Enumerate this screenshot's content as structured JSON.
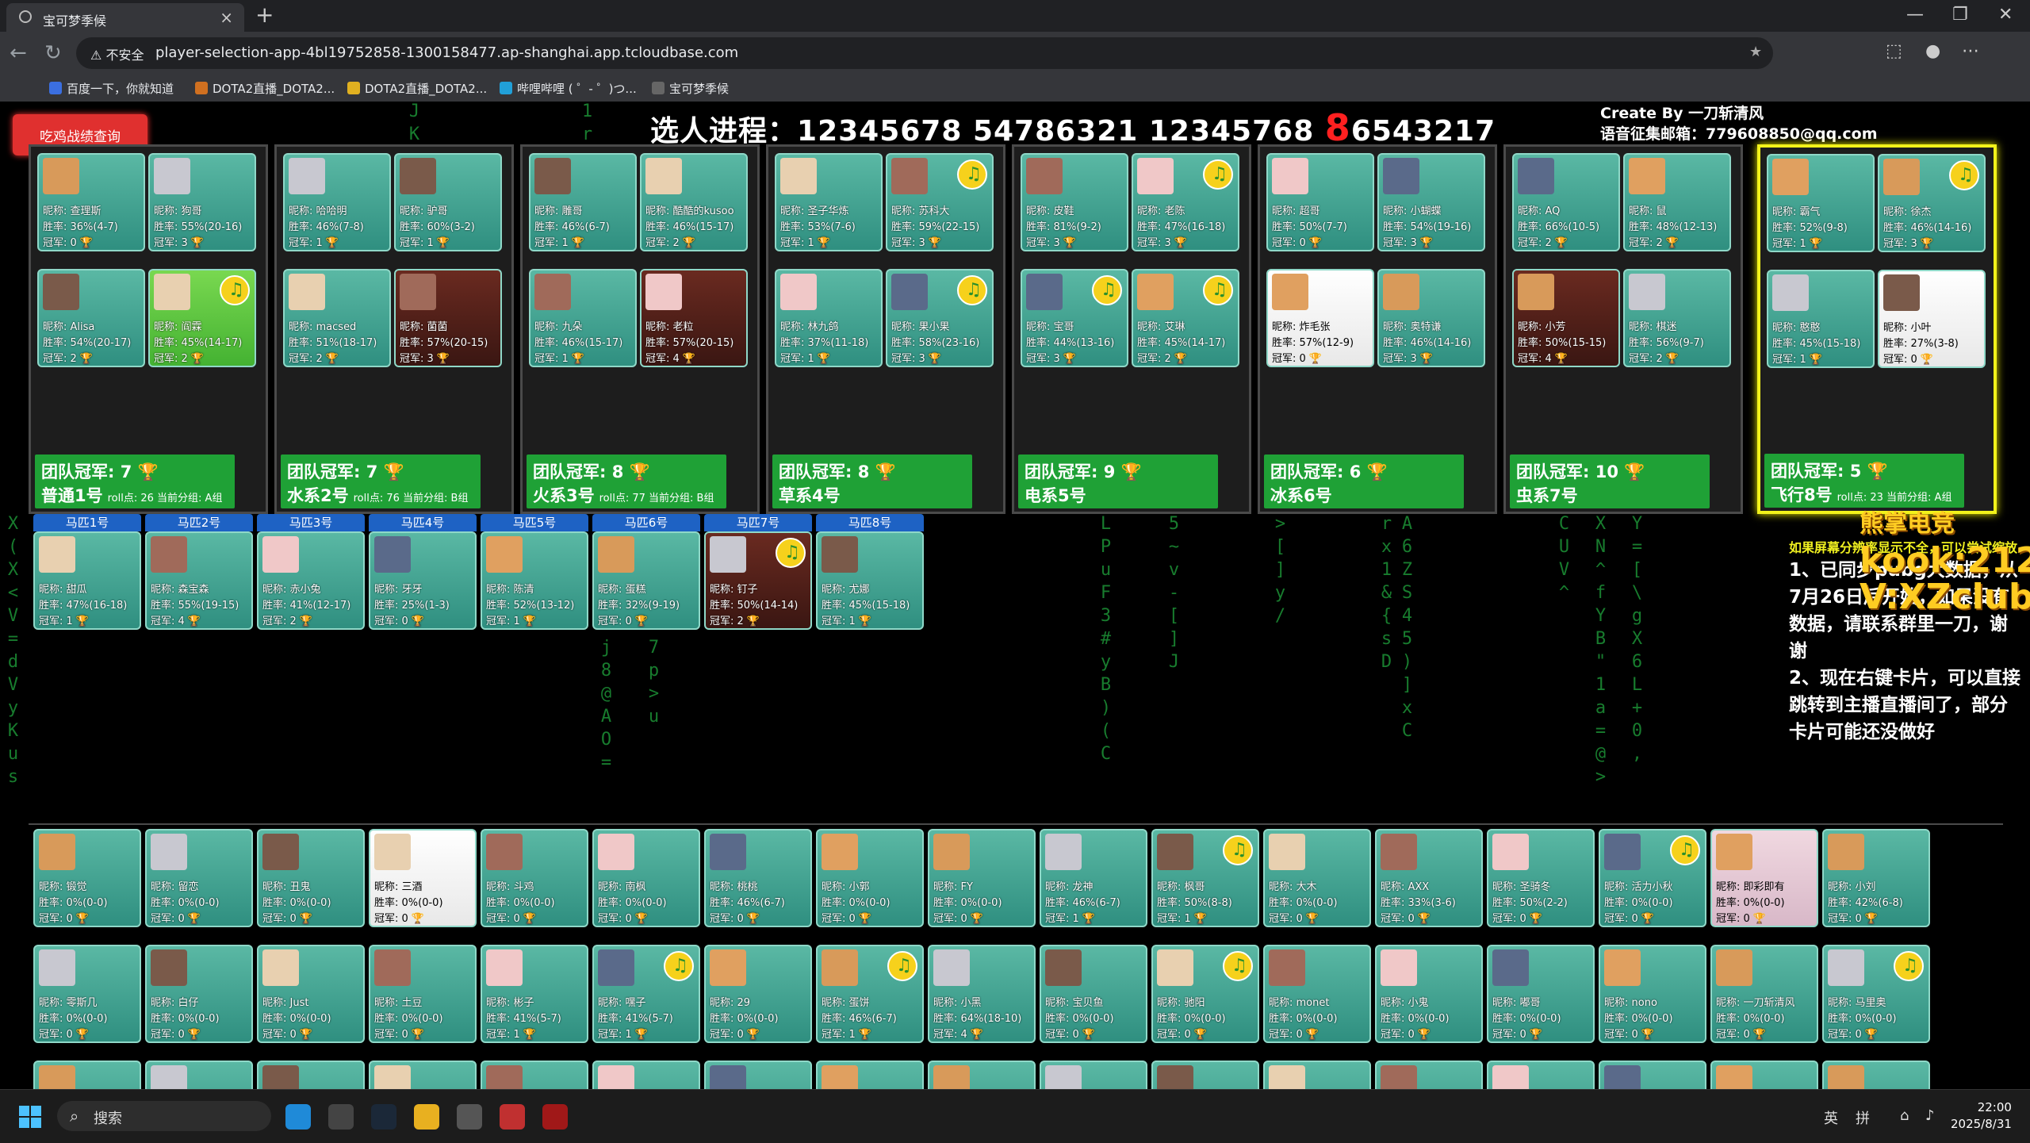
{
  "browser": {
    "tab_title": "宝可梦季候",
    "security_label": "不安全",
    "url": "player-selection-app-4bl19752858-1300158477.ap-shanghai.app.tcloudbase.com",
    "bookmarks": [
      "百度一下，你就知道",
      "DOTA2直播_DOTA2...",
      "DOTA2直播_DOTA2...",
      "哔哩哔哩 ( ゜- ゜)つ...",
      "宝可梦季候"
    ]
  },
  "page": {
    "query_button": "吃鸡战绩查询",
    "progress_label": "选人进程：",
    "progress_seq": "12345678 54786321 12345768 ",
    "progress_red": "8",
    "progress_tail": "6543217",
    "credit_line1": "Create By 一刀斩清风",
    "credit_line2": "语音征集邮箱：779608850@qq.com"
  },
  "teams": [
    {
      "crown": "团队冠军: 7 🏆",
      "name": "普通1号",
      "extra": "roll点: 26 当前分组: A组",
      "players": [
        {
          "n": "昵称: 查理斯",
          "w": "胜率: 36%(4-7)",
          "c": "冠军: 0 🏆"
        },
        {
          "n": "昵称: 狗哥",
          "w": "胜率: 55%(20-16)",
          "c": "冠军: 3 🏆"
        },
        {
          "n": "昵称: Alisa",
          "w": "胜率: 54%(20-17)",
          "c": "冠军: 2 🏆"
        },
        {
          "n": "昵称: 阎霖",
          "w": "胜率: 45%(14-17)",
          "c": "冠军: 2 🏆",
          "hl": true,
          "sp": true
        }
      ]
    },
    {
      "crown": "团队冠军: 7 🏆",
      "name": "水系2号",
      "extra": "roll点: 76 当前分组: B组",
      "players": [
        {
          "n": "昵称: 哈哈明",
          "w": "胜率: 46%(7-8)",
          "c": "冠军: 1 🏆"
        },
        {
          "n": "昵称: 驴哥",
          "w": "胜率: 60%(3-2)",
          "c": "冠军: 1 🏆"
        },
        {
          "n": "昵称: macsed",
          "w": "胜率: 51%(18-17)",
          "c": "冠军: 2 🏆"
        },
        {
          "n": "昵称: 菌菌",
          "w": "胜率: 57%(20-15)",
          "c": "冠军: 3 🏆",
          "dark": true
        }
      ]
    },
    {
      "crown": "团队冠军: 8 🏆",
      "name": "火系3号",
      "extra": "roll点: 77 当前分组: B组",
      "players": [
        {
          "n": "昵称: 雕哥",
          "w": "胜率: 46%(6-7)",
          "c": "冠军: 1 🏆"
        },
        {
          "n": "昵称: 酷酷的kusoo",
          "w": "胜率: 46%(15-17)",
          "c": "冠军: 2 🏆"
        },
        {
          "n": "昵称: 九朵",
          "w": "胜率: 46%(15-17)",
          "c": "冠军: 1 🏆"
        },
        {
          "n": "昵称: 老粒",
          "w": "胜率: 57%(20-15)",
          "c": "冠军: 4 🏆",
          "dark": true
        }
      ]
    },
    {
      "crown": "团队冠军: 8 🏆",
      "name": "草系4号",
      "extra": "",
      "players": [
        {
          "n": "昵称: 圣子华炼",
          "w": "胜率: 53%(7-6)",
          "c": "冠军: 1 🏆"
        },
        {
          "n": "昵称: 苏科大",
          "w": "胜率: 59%(22-15)",
          "c": "冠军: 3 🏆",
          "sp": true
        },
        {
          "n": "昵称: 林九鸽",
          "w": "胜率: 37%(11-18)",
          "c": "冠军: 1 🏆"
        },
        {
          "n": "昵称: 果小果",
          "w": "胜率: 58%(23-16)",
          "c": "冠军: 3 🏆",
          "sp": true
        }
      ]
    },
    {
      "crown": "团队冠军: 9 🏆",
      "name": "电系5号",
      "extra": "",
      "players": [
        {
          "n": "昵称: 皮鞋",
          "w": "胜率: 81%(9-2)",
          "c": "冠军: 3 🏆"
        },
        {
          "n": "昵称: 老陈",
          "w": "胜率: 47%(16-18)",
          "c": "冠军: 3 🏆",
          "sp": true
        },
        {
          "n": "昵称: 宝哥",
          "w": "胜率: 44%(13-16)",
          "c": "冠军: 3 🏆",
          "sp": true
        },
        {
          "n": "昵称: 艾琳",
          "w": "胜率: 45%(14-17)",
          "c": "冠军: 2 🏆",
          "sp": true
        }
      ]
    },
    {
      "crown": "团队冠军: 6 🏆",
      "name": "冰系6号",
      "extra": "",
      "players": [
        {
          "n": "昵称: 超哥",
          "w": "胜率: 50%(7-7)",
          "c": "冠军: 0 🏆"
        },
        {
          "n": "昵称: 小蝴蝶",
          "w": "胜率: 54%(19-16)",
          "c": "冠军: 3 🏆"
        },
        {
          "n": "昵称: 炸毛张",
          "w": "胜率: 57%(12-9)",
          "c": "冠军: 0 🏆",
          "white": true
        },
        {
          "n": "昵称: 奥特谦",
          "w": "胜率: 46%(14-16)",
          "c": "冠军: 3 🏆"
        }
      ]
    },
    {
      "crown": "团队冠军: 10 🏆",
      "name": "虫系7号",
      "extra": "",
      "players": [
        {
          "n": "昵称: AQ",
          "w": "胜率: 66%(10-5)",
          "c": "冠军: 2 🏆"
        },
        {
          "n": "昵称: 鼠",
          "w": "胜率: 48%(12-13)",
          "c": "冠军: 2 🏆"
        },
        {
          "n": "昵称: 小芳",
          "w": "胜率: 50%(15-15)",
          "c": "冠军: 4 🏆",
          "dark": true
        },
        {
          "n": "昵称: 棋迷",
          "w": "胜率: 56%(9-7)",
          "c": "冠军: 2 🏆"
        }
      ]
    },
    {
      "crown": "团队冠军: 5 🏆",
      "name": "飞行8号",
      "extra": "roll点: 23 当前分组: A组",
      "selected": true,
      "players": [
        {
          "n": "昵称: 霸气",
          "w": "胜率: 52%(9-8)",
          "c": "冠军: 1 🏆"
        },
        {
          "n": "昵称: 徐杰",
          "w": "胜率: 46%(14-16)",
          "c": "冠军: 3 🏆",
          "sp": true
        },
        {
          "n": "昵称: 憨憨",
          "w": "胜率: 45%(15-18)",
          "c": "冠军: 1 🏆"
        },
        {
          "n": "昵称: 小叶",
          "w": "胜率: 27%(3-8)",
          "c": "冠军: 0 🏆",
          "white": true
        }
      ]
    }
  ],
  "horses": [
    {
      "label": "马匹1号",
      "n": "昵称: 甜瓜",
      "w": "胜率: 47%(16-18)",
      "c": "冠军: 1 🏆"
    },
    {
      "label": "马匹2号",
      "n": "昵称: 森宝森",
      "w": "胜率: 55%(19-15)",
      "c": "冠军: 4 🏆"
    },
    {
      "label": "马匹3号",
      "n": "昵称: 赤小兔",
      "w": "胜率: 41%(12-17)",
      "c": "冠军: 2 🏆"
    },
    {
      "label": "马匹4号",
      "n": "昵称: 牙牙",
      "w": "胜率: 25%(1-3)",
      "c": "冠军: 0 🏆"
    },
    {
      "label": "马匹5号",
      "n": "昵称: 陈清",
      "w": "胜率: 52%(13-12)",
      "c": "冠军: 1 🏆"
    },
    {
      "label": "马匹6号",
      "n": "昵称: 蛋糕",
      "w": "胜率: 32%(9-19)",
      "c": "冠军: 0 🏆"
    },
    {
      "label": "马匹7号",
      "n": "昵称: 钉子",
      "w": "胜率: 50%(14-14)",
      "c": "冠军: 2 🏆",
      "dark": true,
      "sp": true
    },
    {
      "label": "马匹8号",
      "n": "昵称: 尤娜",
      "w": "胜率: 45%(15-18)",
      "c": "冠军: 1 🏆"
    }
  ],
  "notice": {
    "small": "如果屏幕分辨率显示不全，可以尝试缩放",
    "p1": "1、已同步pubg大数据，从7月26日后开始，如果没有数据，请联系群里一刀，谢谢",
    "p2": "2、现在右键卡片，可以直接跳转到主播直播间了，部分卡片可能还没做好"
  },
  "watermark": {
    "brand": "熊掌电竞",
    "line1": "kook:212",
    "line2": "V:XZclub212"
  },
  "pool": [
    [
      {
        "n": "昵称: 锻觉",
        "w": "胜率: 0%(0-0)",
        "c": "冠军: 0 🏆"
      },
      {
        "n": "昵称: 留恋",
        "w": "胜率: 0%(0-0)",
        "c": "冠军: 0 🏆"
      },
      {
        "n": "昵称: 丑鬼",
        "w": "胜率: 0%(0-0)",
        "c": "冠军: 0 🏆"
      },
      {
        "n": "昵称: 三酒",
        "w": "胜率: 0%(0-0)",
        "c": "冠军: 0 🏆",
        "white": true
      },
      {
        "n": "昵称: 斗鸡",
        "w": "胜率: 0%(0-0)",
        "c": "冠军: 0 🏆"
      },
      {
        "n": "昵称: 南枫",
        "w": "胜率: 0%(0-0)",
        "c": "冠军: 0 🏆"
      },
      {
        "n": "昵称: 桃桃",
        "w": "胜率: 46%(6-7)",
        "c": "冠军: 0 🏆"
      },
      {
        "n": "昵称: 小郭",
        "w": "胜率: 0%(0-0)",
        "c": "冠军: 0 🏆"
      },
      {
        "n": "昵称: FY",
        "w": "胜率: 0%(0-0)",
        "c": "冠军: 0 🏆"
      },
      {
        "n": "昵称: 龙神",
        "w": "胜率: 46%(6-7)",
        "c": "冠军: 1 🏆"
      },
      {
        "n": "昵称: 枫哥",
        "w": "胜率: 50%(8-8)",
        "c": "冠军: 1 🏆",
        "sp": true
      },
      {
        "n": "昵称: 大木",
        "w": "胜率: 0%(0-0)",
        "c": "冠军: 0 🏆"
      },
      {
        "n": "昵称: AXX",
        "w": "胜率: 33%(3-6)",
        "c": "冠军: 0 🏆"
      },
      {
        "n": "昵称: 圣骑冬",
        "w": "胜率: 50%(2-2)",
        "c": "冠军: 0 🏆"
      },
      {
        "n": "昵称: 活力小秋",
        "w": "胜率: 0%(0-0)",
        "c": "冠军: 0 🏆",
        "sp": true
      },
      {
        "n": "昵称: 即彩即有",
        "w": "胜率: 0%(0-0)",
        "c": "冠军: 0 🏆",
        "pink": true
      },
      {
        "n": "昵称: 小刘",
        "w": "胜率: 42%(6-8)",
        "c": "冠军: 0 🏆"
      }
    ],
    [
      {
        "n": "昵称: 零斯几",
        "w": "胜率: 0%(0-0)",
        "c": "冠军: 0 🏆"
      },
      {
        "n": "昵称: 白仔",
        "w": "胜率: 0%(0-0)",
        "c": "冠军: 0 🏆"
      },
      {
        "n": "昵称: Just",
        "w": "胜率: 0%(0-0)",
        "c": "冠军: 0 🏆"
      },
      {
        "n": "昵称: 土豆",
        "w": "胜率: 0%(0-0)",
        "c": "冠军: 0 🏆"
      },
      {
        "n": "昵称: 彬子",
        "w": "胜率: 41%(5-7)",
        "c": "冠军: 1 🏆"
      },
      {
        "n": "昵称: 嘿子",
        "w": "胜率: 41%(5-7)",
        "c": "冠军: 1 🏆",
        "sp": true
      },
      {
        "n": "昵称: 29",
        "w": "胜率: 0%(0-0)",
        "c": "冠军: 0 🏆"
      },
      {
        "n": "昵称: 蛋饼",
        "w": "胜率: 46%(6-7)",
        "c": "冠军: 1 🏆",
        "sp": true
      },
      {
        "n": "昵称: 小黑",
        "w": "胜率: 64%(18-10)",
        "c": "冠军: 4 🏆"
      },
      {
        "n": "昵称: 宝贝鱼",
        "w": "胜率: 0%(0-0)",
        "c": "冠军: 0 🏆"
      },
      {
        "n": "昵称: 驰阳",
        "w": "胜率: 0%(0-0)",
        "c": "冠军: 0 🏆",
        "sp": true
      },
      {
        "n": "昵称: monet",
        "w": "胜率: 0%(0-0)",
        "c": "冠军: 0 🏆"
      },
      {
        "n": "昵称: 小鬼",
        "w": "胜率: 0%(0-0)",
        "c": "冠军: 0 🏆"
      },
      {
        "n": "昵称: 嘟哥",
        "w": "胜率: 0%(0-0)",
        "c": "冠军: 0 🏆"
      },
      {
        "n": "昵称: nono",
        "w": "胜率: 0%(0-0)",
        "c": "冠军: 0 🏆"
      },
      {
        "n": "昵称: 一刀斩清风",
        "w": "胜率: 0%(0-0)",
        "c": "冠军: 0 🏆"
      },
      {
        "n": "昵称: 马里奥",
        "w": "胜率: 0%(0-0)",
        "c": "冠军: 0 🏆",
        "sp": true
      }
    ]
  ],
  "taskbar": {
    "search": "搜索",
    "ime1": "英",
    "ime2": "拼",
    "time": "22:00",
    "date": "2025/8/31"
  }
}
